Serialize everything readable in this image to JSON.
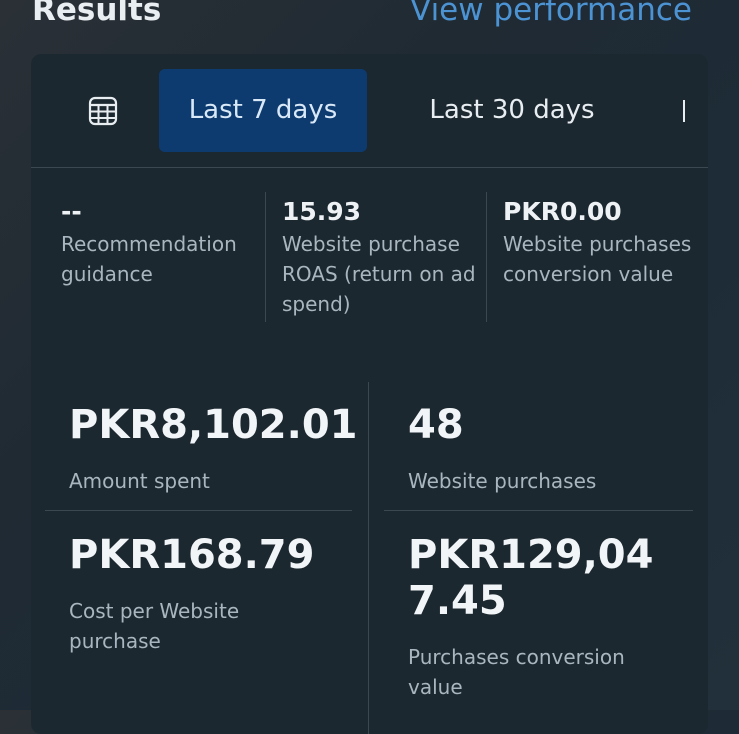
{
  "header": {
    "title": "Results",
    "link": "View performance"
  },
  "tabs": {
    "icon": "table-grid-icon",
    "items": [
      {
        "label": "Last 7 days",
        "active": true
      },
      {
        "label": "Last 30 days",
        "active": false
      }
    ]
  },
  "summary": [
    {
      "value": "--",
      "label": "Recommendation guidance"
    },
    {
      "value": "15.93",
      "label": "Website purchase ROAS (return on ad spend)"
    },
    {
      "value": "PKR0.00",
      "label": "Website purchases conversion value"
    }
  ],
  "metrics": [
    {
      "value": "PKR8,102.01",
      "label": "Amount spent"
    },
    {
      "value": "48",
      "label": "Website purchases"
    },
    {
      "value": "PKR168.79",
      "label": "Cost per Website purchase"
    },
    {
      "value": "PKR129,047.45",
      "label": "Purchases conversion value"
    }
  ],
  "colors": {
    "accent": "#4c93d4",
    "active_tab_bg": "#0d3b70",
    "card_bg": "#1c2830"
  }
}
